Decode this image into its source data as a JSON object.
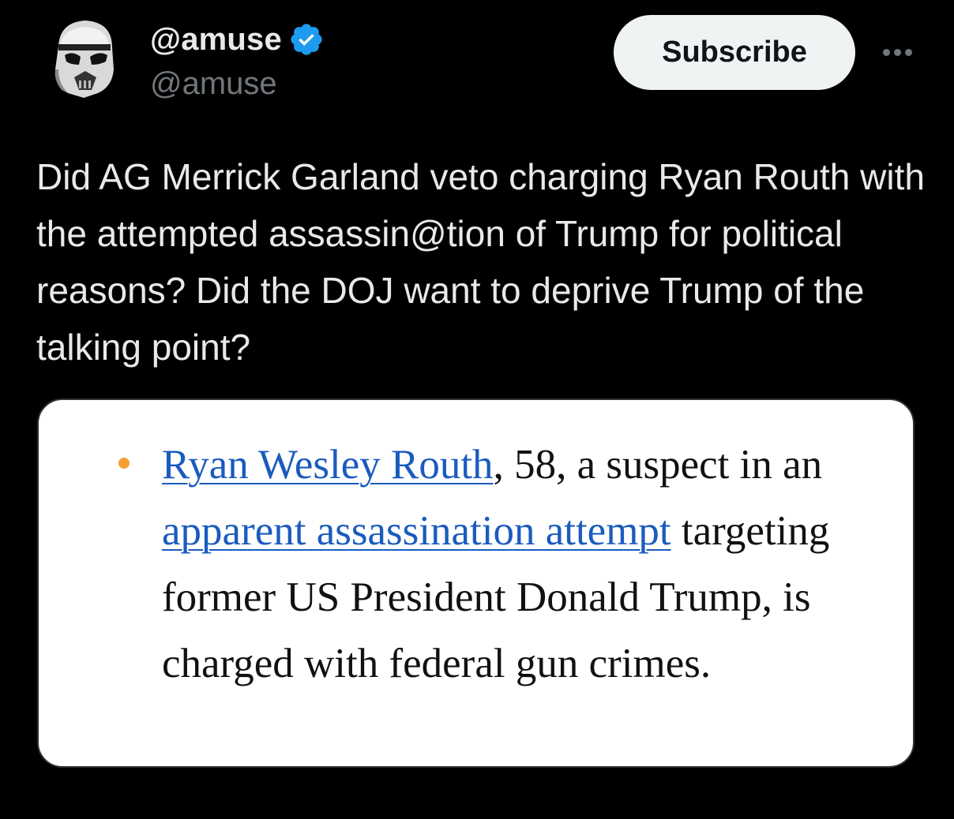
{
  "post": {
    "author": {
      "display_name": "@amuse",
      "handle": "@amuse",
      "verified": true,
      "avatar_icon": "stormtrooper-helmet-avatar"
    },
    "subscribe_label": "Subscribe",
    "more_icon": "more-horizontal-icon",
    "text": "Did AG Merrick Garland veto charging Ryan Routh with the attempted assassin@tion of Trump for political reasons? Did the DOJ want to deprive Trump of the talking point?"
  },
  "media": {
    "bullet_color": "#f5a033",
    "link_color": "#1a5bbf",
    "link1": "Ryan Wesley Routh",
    "text1": ", 58, a suspect in an ",
    "link2": "apparent assassination attempt",
    "text2": " targeting former US President Donald Trump, is charged with federal gun crimes."
  },
  "colors": {
    "background": "#000000",
    "primary_text": "#e7e9ea",
    "secondary_text": "#71767b",
    "verified_badge": "#1d9bf0",
    "subscribe_bg": "#eff3f4"
  }
}
